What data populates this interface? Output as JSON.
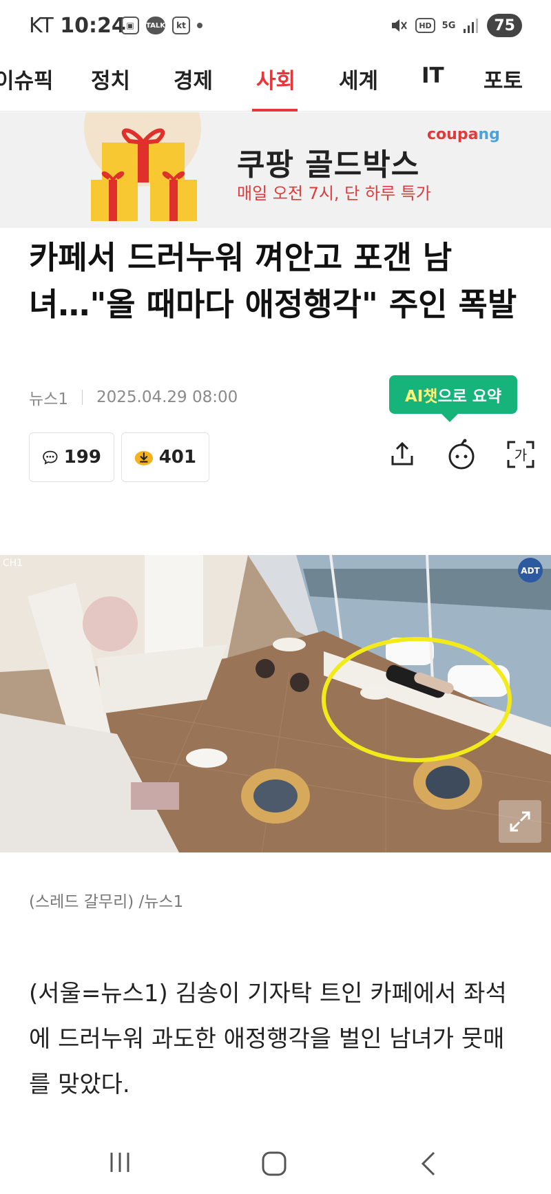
{
  "status_bar": {
    "carrier": "KT",
    "time": "10:24",
    "talk_label": "TALK",
    "kt_label": "kt",
    "hd_label": "HD",
    "network_label": "5G",
    "battery": "75"
  },
  "nav": {
    "tabs": [
      {
        "label": "이슈픽",
        "active": false
      },
      {
        "label": "정치",
        "active": false
      },
      {
        "label": "경제",
        "active": false
      },
      {
        "label": "사회",
        "active": true
      },
      {
        "label": "세계",
        "active": false
      },
      {
        "label": "IT",
        "active": false
      },
      {
        "label": "포토",
        "active": false
      }
    ]
  },
  "ad": {
    "title": "쿠팡 골드박스",
    "subtitle": "매일 오전 7시, 단 하루 특가",
    "brand_main": "coupa",
    "brand_tail": "ng"
  },
  "article": {
    "headline": "카페서 드러누워 껴안고 포갠 남녀…\"올 때마다 애정행각\" 주인 폭발",
    "source": "뉴스1",
    "datetime": "2025.04.29 08:00",
    "ai_button_highlight": "AI챗",
    "ai_button_rest": "으로 요약",
    "comment_count": "199",
    "reaction_count": "401",
    "photo_watermark": "CH1",
    "photo_brand": "ADT",
    "photo_caption": "(스레드 갈무리) /뉴스1",
    "body": "(서울=뉴스1) 김송이 기자탁 트인 카페에서 좌석에 드러누워 과도한 애정행각을 벌인 남녀가 뭇매를 맞았다."
  },
  "colors": {
    "accent_red": "#e8363b",
    "ai_green": "#16b47b",
    "highlight_circle": "#f2ea1a"
  }
}
